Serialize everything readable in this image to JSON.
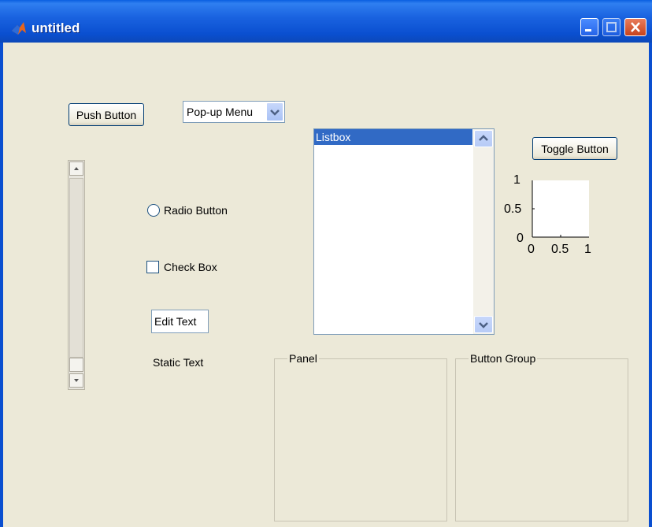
{
  "window": {
    "title": "untitled"
  },
  "controls": {
    "push_button": "Push Button",
    "popup_menu": {
      "selected": "Pop-up Menu"
    },
    "listbox": {
      "items": [
        "Listbox"
      ],
      "selected_index": 0
    },
    "toggle_button": "Toggle Button",
    "radio_button": "Radio Button",
    "check_box": "Check Box",
    "edit_text": "Edit Text",
    "static_text": "Static Text",
    "panel_title": "Panel",
    "button_group_title": "Button Group"
  },
  "axes": {
    "y_ticks": [
      "1",
      "0.5",
      "0"
    ],
    "x_ticks": [
      "0",
      "0.5",
      "1"
    ]
  },
  "icons": {
    "app": "matlab-logo-icon",
    "minimize": "minimize-icon",
    "maximize": "maximize-icon",
    "close": "close-icon"
  },
  "colors": {
    "titlebar": "#0a4fd0",
    "selection": "#316ac5",
    "background": "#ece9d8"
  }
}
